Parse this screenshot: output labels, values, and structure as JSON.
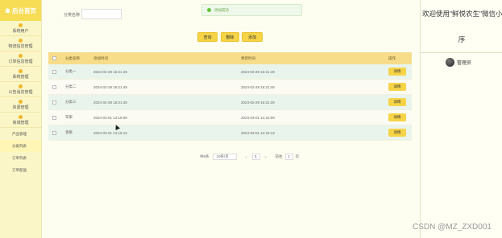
{
  "sidebar": {
    "brand": "后台首页",
    "groups": [
      {
        "label": "系统用户"
      },
      {
        "label": "物流信息管理"
      },
      {
        "label": "订单信息管理"
      },
      {
        "label": "系统管理"
      },
      {
        "label": "公告消息管理"
      },
      {
        "label": "资源管理"
      },
      {
        "label": "商城管理"
      }
    ],
    "submenu": [
      {
        "label": "产品管理"
      },
      {
        "label": "分类列表"
      },
      {
        "label": "订单列表"
      },
      {
        "label": "订单配送"
      }
    ]
  },
  "filter": {
    "label": "分类名称",
    "placeholder": ""
  },
  "toast": {
    "text": "添加成功"
  },
  "buttons": {
    "query": "查询",
    "delete": "删除",
    "add": "添加"
  },
  "table": {
    "headers": {
      "name": "分类名称",
      "created": "添加时间",
      "updated": "更新时间",
      "op": "操作"
    },
    "rows": [
      {
        "name": "分类一",
        "created": "2024-02-29 16:21:49",
        "updated": "2024-02-29 16:21:49",
        "op": "详情"
      },
      {
        "name": "分类二",
        "created": "2024-02-29 16:21:49",
        "updated": "2024-02-29 16:21:49",
        "op": "详情"
      },
      {
        "name": "分类三",
        "created": "2024-02-29 16:21:49",
        "updated": "2024-02-29 16:21:49",
        "op": "详情"
      },
      {
        "name": "苹果",
        "created": "2024-03-01 14:16:09",
        "updated": "2024-03-01 14:16:09",
        "op": "详情"
      },
      {
        "name": "香蕉",
        "created": "2024-03-01 14:16:13",
        "updated": "2024-03-01 14:16:13",
        "op": "详情"
      }
    ]
  },
  "pager": {
    "total": "共5条",
    "per_page": "10条/页",
    "current": "1",
    "goto": "前往",
    "goto_value": "1",
    "page_unit": "页",
    "prev": "<",
    "next": ">"
  },
  "right": {
    "welcome": "欢迎使用\"鲜悦农生\"微信小程",
    "welcome2": "序",
    "admin": "管理员"
  },
  "watermark": "CSDN @MZ_ZXD001"
}
